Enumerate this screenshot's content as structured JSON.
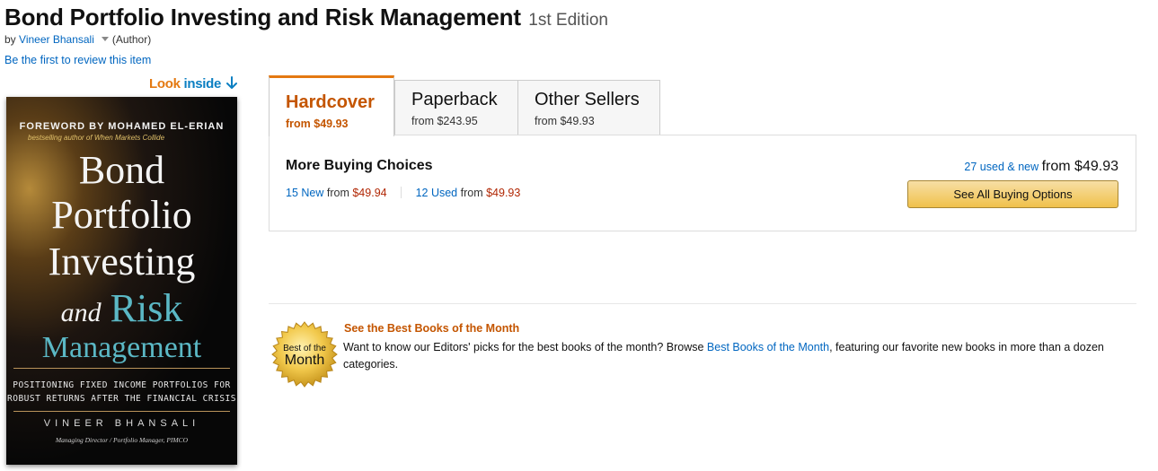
{
  "product": {
    "title": "Bond Portfolio Investing and Risk Management",
    "edition": "1st Edition",
    "by_prefix": "by",
    "author_name": "Vineer Bhansali",
    "author_role": "(Author)",
    "review_link": "Be the first to review this item"
  },
  "look_inside": {
    "word1": "Look",
    "word2": "inside",
    "icon": "down-arrow-icon"
  },
  "cover": {
    "foreword": "FOREWORD BY MOHAMED EL-ERIAN",
    "bestseller": "bestselling author of When Markets Collide",
    "line1": "Bond",
    "line2": "Portfolio",
    "line3": "Investing",
    "line4_and": "and",
    "line4_risk": "Risk",
    "line5": "Management",
    "subtitle1": "POSITIONING FIXED INCOME PORTFOLIOS FOR",
    "subtitle2": "ROBUST RETURNS AFTER THE FINANCIAL CRISIS",
    "author": "VINEER BHANSALI",
    "author_role": "Managing Director / Portfolio Manager, PIMCO"
  },
  "tabs": [
    {
      "name": "Hardcover",
      "from": "from $49.93",
      "selected": true
    },
    {
      "name": "Paperback",
      "from": "from $243.95",
      "selected": false
    },
    {
      "name": "Other Sellers",
      "from": "from $49.93",
      "selected": false
    }
  ],
  "buying": {
    "heading": "More Buying Choices",
    "new_link": "15 New",
    "new_from": "from",
    "new_price": "$49.94",
    "used_link": "12 Used",
    "used_from": "from",
    "used_price": "$49.93",
    "summary_link": "27 used & new",
    "summary_from": "from $49.93",
    "button_label": "See All Buying Options"
  },
  "best_books": {
    "seal_line1": "Best of the",
    "seal_line2": "Month",
    "heading": "See the Best Books of the Month",
    "text_before": "Want to know our Editors' picks for the best books of the month? Browse ",
    "link": "Best Books of the Month",
    "text_after": ", featuring our favorite new books in more than a dozen categories."
  },
  "colors": {
    "link": "#0066c0",
    "price": "#b12704",
    "accent_orange": "#e47911",
    "selected_tab_text": "#c45500",
    "button_gold": "#f0c14b"
  }
}
